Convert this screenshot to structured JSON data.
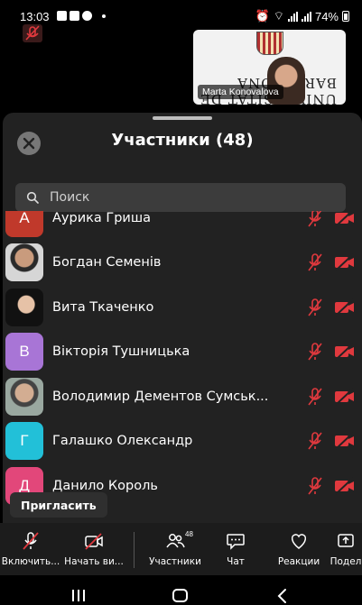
{
  "status_bar": {
    "time": "13:03",
    "battery": "74%"
  },
  "video_thumb": {
    "name": "Marta Konovalova",
    "background_text": "UNIVERSITAT DE BARCELONA"
  },
  "sheet": {
    "title": "Участники (48)",
    "search_placeholder": "Поиск"
  },
  "participants": [
    {
      "name": "Аурика Гриша",
      "initial": "А",
      "avatar_color": "#c0392b",
      "mic": "muted",
      "camera": "off"
    },
    {
      "name": "Богдан Семенів",
      "initial": "",
      "avatar_color": "photo",
      "mic": "muted",
      "camera": "off"
    },
    {
      "name": "Вита Ткаченко",
      "initial": "",
      "avatar_color": "photo",
      "mic": "muted",
      "camera": "off"
    },
    {
      "name": "Вікторія Тушницька",
      "initial": "В",
      "avatar_color": "#a875d6",
      "mic": "muted",
      "camera": "off"
    },
    {
      "name": "Володимир Дементов Сумськ...",
      "initial": "",
      "avatar_color": "photo",
      "mic": "muted",
      "camera": "off"
    },
    {
      "name": "Галашко Олександр",
      "initial": "Г",
      "avatar_color": "#22c0d8",
      "mic": "muted",
      "camera": "off"
    },
    {
      "name": "Данило Король",
      "initial": "Д",
      "avatar_color": "#e2477a",
      "mic": "muted",
      "camera": "off"
    }
  ],
  "invite_label": "Пригласить",
  "toolbar": {
    "unmute_label": "Включить...",
    "video_label": "Начать ви...",
    "participants_label": "Участники",
    "participants_count": "48",
    "chat_label": "Чат",
    "reactions_label": "Реакции",
    "share_label": "Подел"
  },
  "colors": {
    "muted_red": "#e0393e",
    "sheet_bg": "#222222",
    "toolbar_bg": "#1c1c1c"
  }
}
